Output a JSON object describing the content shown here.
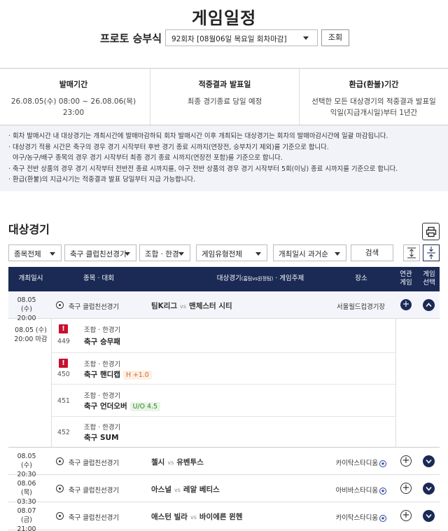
{
  "page": {
    "title": "게임일정",
    "product_label": "프로토 승부식",
    "round_select_value": "92회차 [08월06일 목요일 회차마감]",
    "lookup_button": "조회"
  },
  "info": [
    {
      "heading": "발매기간",
      "lines": [
        "26.08.05(수) 08:00 ~ 26.08.06(목) 23:00"
      ]
    },
    {
      "heading": "적중결과 발표일",
      "lines": [
        "최종 경기종료 당일 예정"
      ]
    },
    {
      "heading": "환급(환불)기간",
      "lines": [
        "선택한 모든 대상경기의 적중결과 발표일",
        "익일(지급개시일)부터 1년간"
      ]
    }
  ],
  "notices": [
    "회차 발매시간 내 대상경기는 개최시간에 발매마감하되 회차 발매시간 이후 개최되는 대상경기는 회차의 발매마감시간에 일괄 마감됩니다.",
    "대상경기 적용 시간은 축구의 경우 경기 시작부터 후반 경기 종료 시까지(연장전, 승부차기 제외)를 기준으로 합니다.",
    "야구/농구/배구 종목의 경우 경기 시작부터 최종 경기 종료 시까지(연장전 포함)를 기준으로 합니다.",
    "축구 전반 상품의 경우 경기 시작부터 전반전 종료 시까지를, 야구 전반 상품의 경우 경기 시작부터 5회(이닝) 종료 시까지를 기준으로 합니다.",
    "환급(환불)의 지급시기는 적중결과 발표 당일부터 지급 가능합니다."
  ],
  "section": {
    "title": "대상경기",
    "print_icon": "printer-icon"
  },
  "filters": {
    "sport": "종목전체",
    "league": "축구 클럽친선경기",
    "combo": "조합 · 한경",
    "game_type": "게임유형전체",
    "order": "개최일시 과거순",
    "search_button": "검색"
  },
  "table_headers": {
    "datetime": "개최일시",
    "sport_league": "종목 · 대회",
    "match_prefix": "대상경기",
    "match_small": "(홈팀vs원정팀)",
    "match_suffix": " · 게임주제",
    "venue": "장소",
    "related_1": "연관",
    "related_2": "게임",
    "select_1": "게임",
    "select_2": "선택"
  },
  "matches": [
    {
      "date": "08.05 (수)",
      "time": "20:00",
      "league": "축구 클럽친선경기",
      "home": "팀K리그",
      "vs": "vs",
      "away": "맨체스터 시티",
      "venue": "서울월드컵경기장",
      "star": false,
      "expanded": true
    },
    {
      "date": "08.05 (수)",
      "time": "20:30",
      "league": "축구 클럽친선경기",
      "home": "첼시",
      "vs": "vs",
      "away": "유벤투스",
      "venue": "카이탁스타디움",
      "star": true,
      "expanded": false
    },
    {
      "date": "08.06 (목)",
      "time": "03:30",
      "league": "축구 클럽친선경기",
      "home": "아스널",
      "vs": "vs",
      "away": "레알 베티스",
      "venue": "아비바스타디움",
      "star": true,
      "expanded": false
    },
    {
      "date": "08.07 (금)",
      "time": "21:00",
      "league": "축구 클럽친선경기",
      "home": "애스턴 빌라",
      "vs": "vs",
      "away": "바이에른 뮌헨",
      "venue": "카이탁스타디움",
      "star": true,
      "expanded": false
    }
  ],
  "expanded_detail": {
    "date": "08.05 (수)",
    "time_close": "20:00 마감",
    "games": [
      {
        "no": "449",
        "category": "조합 · 한경기",
        "name": "축구 승무패",
        "tag": "",
        "warning": true
      },
      {
        "no": "450",
        "category": "조합 · 한경기",
        "name": "축구 핸디캡",
        "tag": "H +1.0",
        "tag_type": "h",
        "warning": true
      },
      {
        "no": "451",
        "category": "조합 · 한경기",
        "name": "축구 언더오버",
        "tag": "U/O 4.5",
        "tag_type": "uo",
        "warning": false
      },
      {
        "no": "452",
        "category": "조합 · 한경기",
        "name": "축구 SUM",
        "tag": "",
        "warning": false
      }
    ]
  },
  "colors": {
    "navy": "#1b2a55",
    "warning": "#c8102e",
    "handicap": "#d2691e",
    "underover": "#2e7d32"
  }
}
